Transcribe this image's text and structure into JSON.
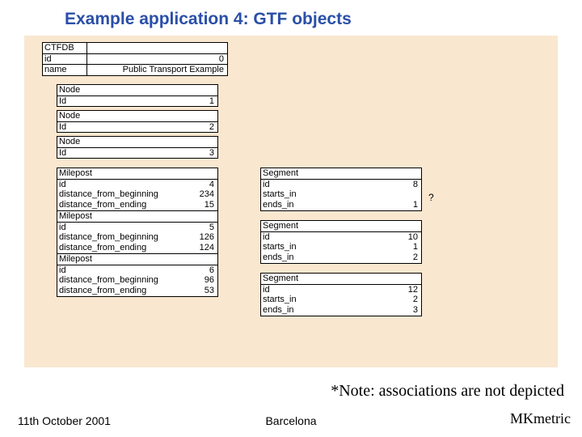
{
  "title": "Example application 4: GTF objects",
  "ctfdb": {
    "head": "CTFDB",
    "id_label": "id",
    "id": "0",
    "name_label": "name",
    "name": "Public Transport Example"
  },
  "nodes": [
    {
      "head": "Node",
      "id_label": "Id",
      "id": "1"
    },
    {
      "head": "Node",
      "id_label": "Id",
      "id": "2"
    },
    {
      "head": "Node",
      "id_label": "Id",
      "id": "3"
    }
  ],
  "mileposts": [
    {
      "head": "Milepost",
      "id_label": "id",
      "id": "4",
      "dfb_label": "distance_from_beginning",
      "dfb": "234",
      "dfe_label": "distance_from_ending",
      "dfe": "15"
    },
    {
      "head": "Milepost",
      "id_label": "id",
      "id": "5",
      "dfb_label": "distance_from_beginning",
      "dfb": "126",
      "dfe_label": "distance_from_ending",
      "dfe": "124"
    },
    {
      "head": "Milepost",
      "id_label": "id",
      "id": "6",
      "dfb_label": "distance_from_beginning",
      "dfb": "96",
      "dfe_label": "distance_from_ending",
      "dfe": "53"
    }
  ],
  "segments": [
    {
      "head": "Segment",
      "id_label": "id",
      "id": "8",
      "starts_label": "starts_in",
      "starts": "",
      "ends_label": "ends_in",
      "ends": "1",
      "q": "?"
    },
    {
      "head": "Segment",
      "id_label": "id",
      "id": "10",
      "starts_label": "starts_in",
      "starts": "1",
      "ends_label": "ends_in",
      "ends": "2",
      "q": ""
    },
    {
      "head": "Segment",
      "id_label": "id",
      "id": "12",
      "starts_label": "starts_in",
      "starts": "2",
      "ends_label": "ends_in",
      "ends": "3",
      "q": ""
    }
  ],
  "footnote": "*Note: associations are not depicted",
  "footer": {
    "left": "11th October 2001",
    "center": "Barcelona",
    "right": "MKmetric"
  }
}
